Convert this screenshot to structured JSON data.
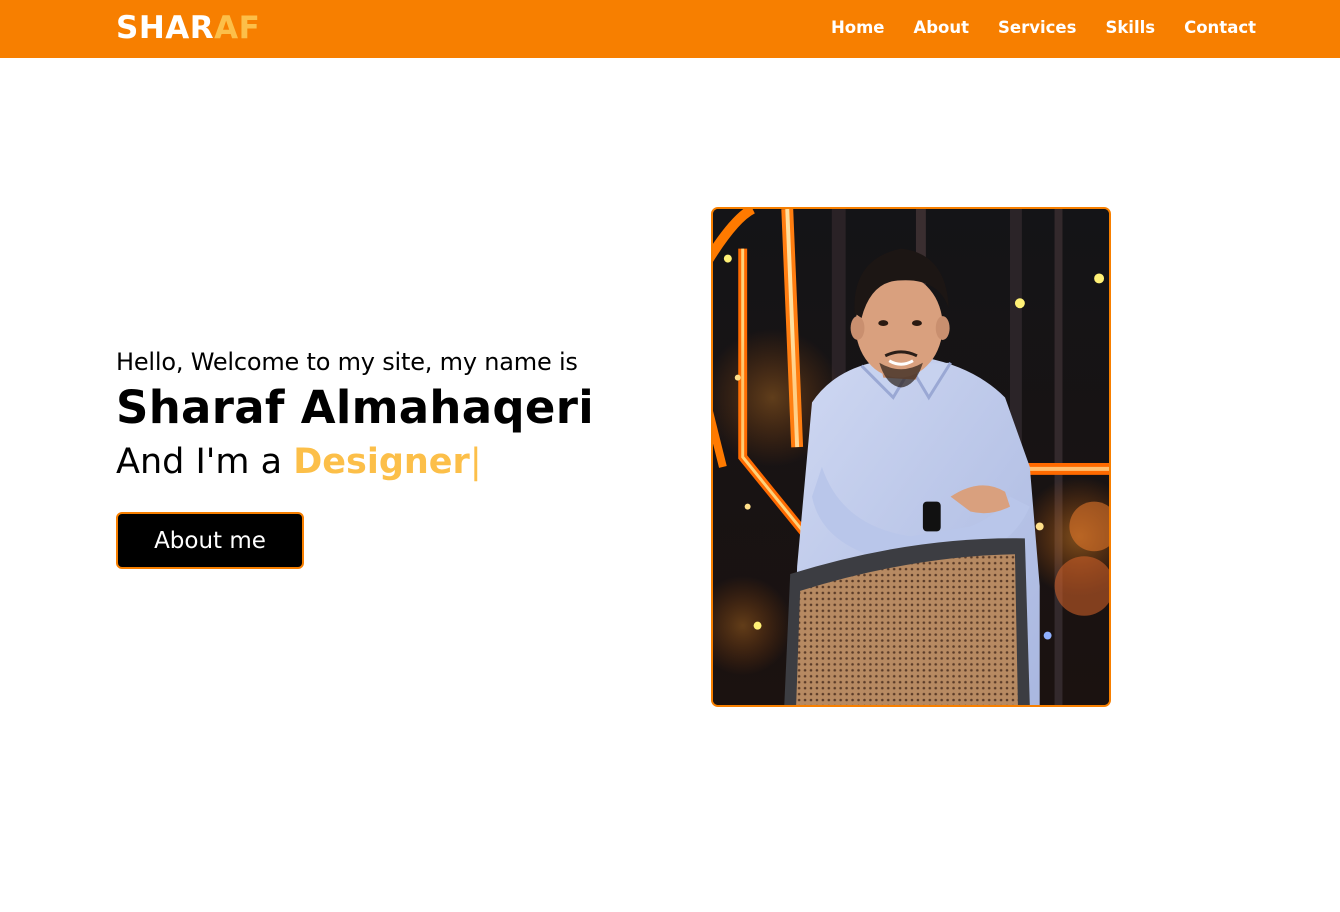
{
  "nav": {
    "logo_main": "SHAR",
    "logo_accent": "AF",
    "links": [
      "Home",
      "About",
      "Services",
      "Skills",
      "Contact"
    ]
  },
  "hero": {
    "greeting": "Hello, Welcome to my site, my name is",
    "name": "Sharaf Almahaqeri",
    "role_prefix": "And I'm a ",
    "role": "Designer",
    "cursor": "|",
    "button_label": "About me"
  },
  "colors": {
    "primary": "#f77f00",
    "accent": "#fcbf49",
    "text": "#000000",
    "button_bg": "#000000",
    "background": "#ffffff"
  },
  "icons": {
    "profile_photo": "person-portrait"
  }
}
